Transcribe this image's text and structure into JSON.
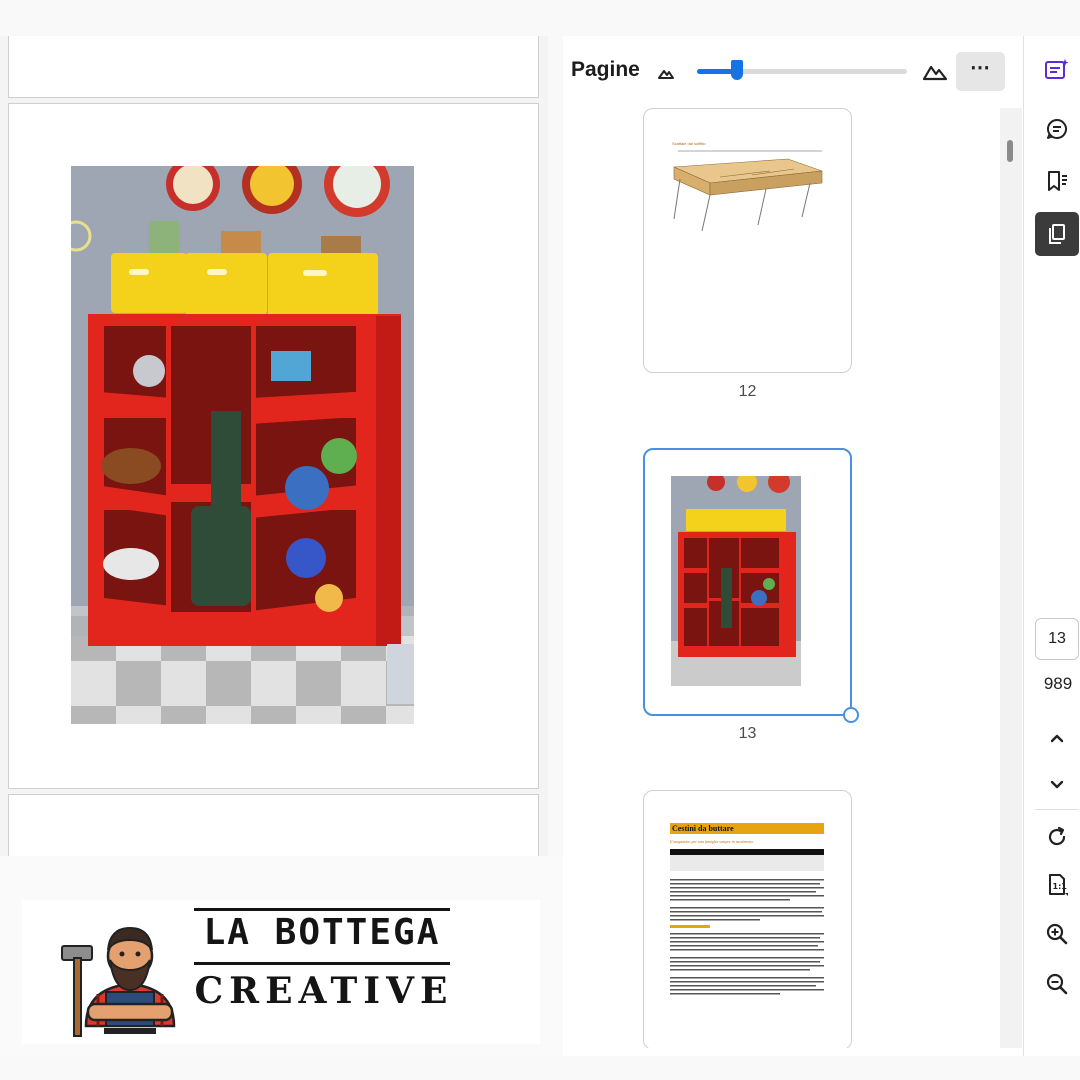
{
  "panel": {
    "title": "Pagine",
    "zoom_slider_value": 0.19,
    "more_label": "⋯"
  },
  "thumbnails": [
    {
      "page": "12",
      "heading": "Scaffale dal soffitto",
      "selected": false
    },
    {
      "page": "13",
      "selected": true
    },
    {
      "page": "14",
      "heading": "Cestini da buttare",
      "subheading": "Il magazzino per una famiglia sempre in movimento",
      "selected": false
    }
  ],
  "pager": {
    "current": "13",
    "total": "989"
  },
  "brand": {
    "line1": "LA BOTTEGA",
    "line2": "CREATIVE"
  },
  "colors": {
    "accent": "#1473e6",
    "shelf_red": "#e3261d",
    "basket_yellow": "#f4d21b",
    "heading_orange": "#e8a310"
  },
  "icons": [
    "mountain-small-icon",
    "mountain-large-icon",
    "more-options-icon",
    "ai-assistant-icon",
    "comment-icon",
    "bookmark-icon",
    "pages-icon",
    "chevron-up-icon",
    "chevron-down-icon",
    "rotate-icon",
    "actual-size-icon",
    "zoom-in-icon",
    "zoom-out-icon"
  ]
}
